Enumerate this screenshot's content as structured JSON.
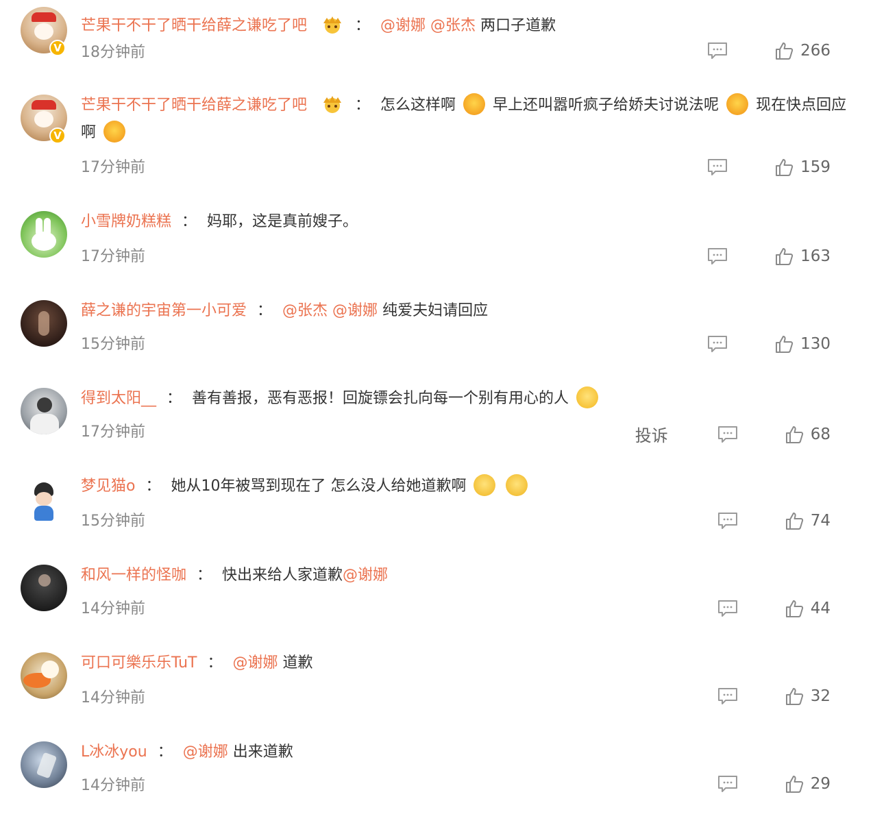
{
  "comments": [
    {
      "user": "芒果干不干了晒干给薛之谦吃了吧",
      "verified": true,
      "crown": true,
      "mentions": [
        "@谢娜",
        "@张杰"
      ],
      "text": "两口子道歉",
      "time": "18分钟前",
      "likes": "266"
    },
    {
      "user": "芒果干不干了晒干给薛之谦吃了吧",
      "verified": true,
      "crown": true,
      "text_parts": [
        "怎么这样啊",
        "早上还叫嚣听疯子给娇夫讨说法呢",
        "现在快点回应啊"
      ],
      "time": "17分钟前",
      "likes": "159"
    },
    {
      "user": "小雪牌奶糕糕",
      "text": "妈耶，这是真前嫂子。",
      "time": "17分钟前",
      "likes": "163"
    },
    {
      "user": "薛之谦的宇宙第一小可爱",
      "mentions": [
        "@张杰",
        "@谢娜"
      ],
      "text": "纯爱夫妇请回应",
      "time": "15分钟前",
      "likes": "130"
    },
    {
      "user": "得到太阳__",
      "text": "善有善报，恶有恶报！回旋镖会扎向每一个别有用心的人",
      "time": "17分钟前",
      "report": "投诉",
      "likes": "68"
    },
    {
      "user": "梦见猫o",
      "text": "她从10年被骂到现在了 怎么没人给她道歉啊",
      "time": "15分钟前",
      "likes": "74"
    },
    {
      "user": "和风一样的怪咖",
      "text": "快出来给人家道歉",
      "mentions": [
        "@谢娜"
      ],
      "time": "14分钟前",
      "likes": "44"
    },
    {
      "user": "可口可樂乐乐TuT",
      "mentions": [
        "@谢娜"
      ],
      "text": "道歉",
      "time": "14分钟前",
      "likes": "32"
    },
    {
      "user": "L冰冰you",
      "mentions": [
        "@谢娜"
      ],
      "text": "出来道歉",
      "time": "14分钟前",
      "likes": "29"
    }
  ],
  "colon": "：",
  "badge": "V",
  "colors": {
    "username": "#eb7350",
    "mention": "#eb7350",
    "text": "#333333",
    "time": "#888888",
    "badge": "#f7b500"
  },
  "icons": {
    "comment": "comment-bubble-icon",
    "like": "thumbs-up-icon"
  }
}
